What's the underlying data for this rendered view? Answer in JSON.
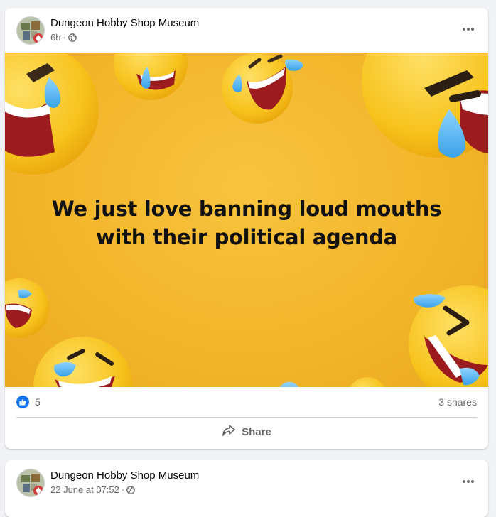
{
  "colors": {
    "page_bg": "#f0f2f5",
    "card_bg": "#ffffff",
    "accent": "#1877f2",
    "image_bg": "#f2b52a"
  },
  "posts": [
    {
      "author": "Dungeon Hobby Shop Museum",
      "time": "6h",
      "time_separator": "·",
      "image_text": "We just love banning loud mouths with their political agenda",
      "reaction_count": "5",
      "shares": "3 shares",
      "share_label": "Share",
      "icons": {
        "more": "more-options-icon",
        "audience": "globe-icon",
        "reaction": "like-icon",
        "share": "share-icon"
      }
    },
    {
      "author": "Dungeon Hobby Shop Museum",
      "time": "22 June at 07:52",
      "time_separator": "·",
      "icons": {
        "more": "more-options-icon",
        "audience": "globe-icon"
      }
    }
  ]
}
